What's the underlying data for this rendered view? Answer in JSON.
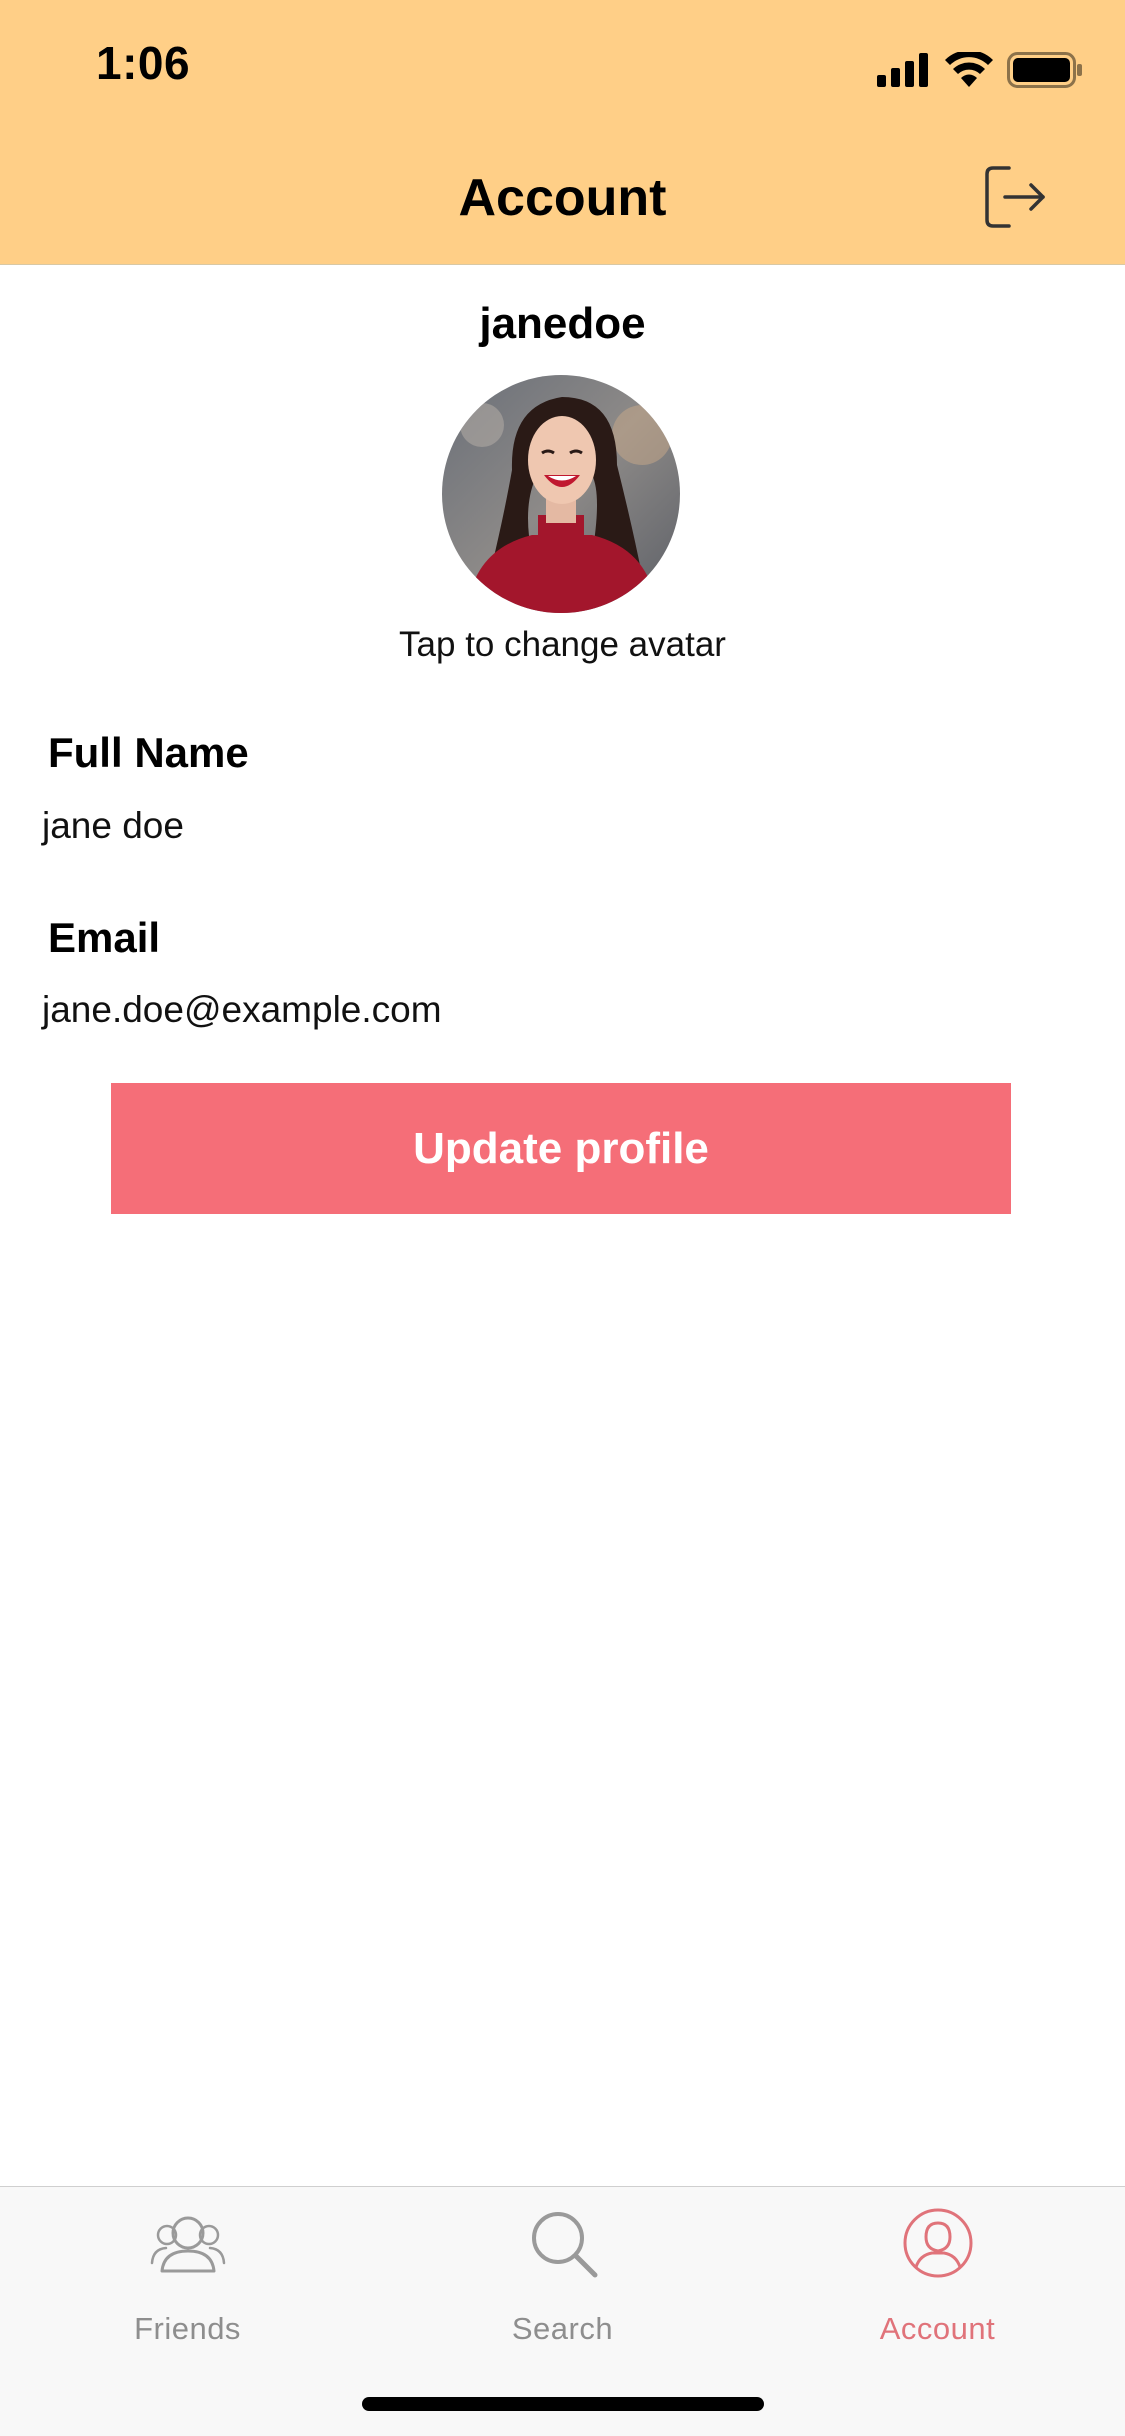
{
  "status_bar": {
    "time": "1:06"
  },
  "nav": {
    "title": "Account"
  },
  "profile": {
    "username": "janedoe",
    "avatar_hint": "Tap to change avatar",
    "full_name_label": "Full Name",
    "full_name_value": "jane doe",
    "email_label": "Email",
    "email_value": "jane.doe@example.com",
    "update_button": "Update profile"
  },
  "tabs": [
    {
      "label": "Friends",
      "icon": "friends-icon",
      "active": false
    },
    {
      "label": "Search",
      "icon": "search-icon",
      "active": false
    },
    {
      "label": "Account",
      "icon": "account-icon",
      "active": true
    }
  ],
  "colors": {
    "header_bg": "#FFCF87",
    "button_bg": "#F56E78",
    "tab_active": "#E0737A",
    "tab_inactive": "#8E8E8E"
  }
}
